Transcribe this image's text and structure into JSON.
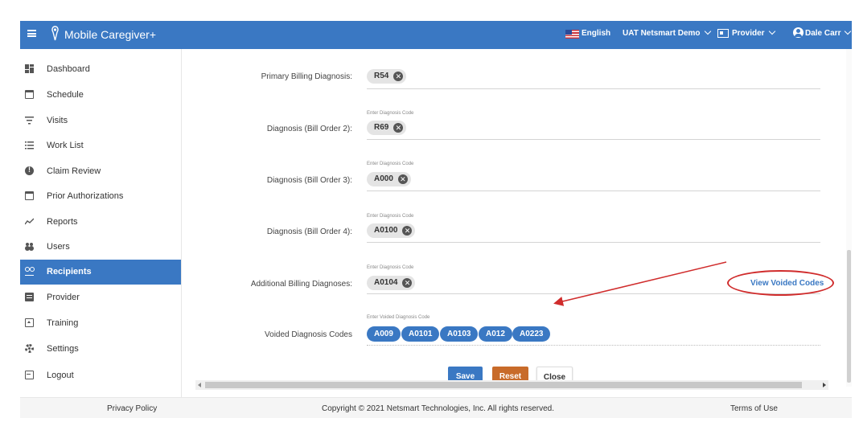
{
  "header": {
    "app_name": "Mobile Caregiver+",
    "language": "English",
    "environment": "UAT Netsmart Demo",
    "role": "Provider",
    "user": "Dale Carr"
  },
  "sidebar": {
    "items": [
      {
        "label": "Dashboard",
        "icon": "dashboard-icon"
      },
      {
        "label": "Schedule",
        "icon": "calendar-icon"
      },
      {
        "label": "Visits",
        "icon": "filter-icon"
      },
      {
        "label": "Work List",
        "icon": "list-icon"
      },
      {
        "label": "Claim Review",
        "icon": "alert-icon"
      },
      {
        "label": "Prior Authorizations",
        "icon": "calendar-icon"
      },
      {
        "label": "Reports",
        "icon": "chart-line-icon"
      },
      {
        "label": "Users",
        "icon": "users-icon"
      },
      {
        "label": "Recipients",
        "icon": "recipients-icon",
        "active": true
      },
      {
        "label": "Provider",
        "icon": "provider-icon"
      },
      {
        "label": "Training",
        "icon": "training-icon"
      },
      {
        "label": "Settings",
        "icon": "gear-icon"
      },
      {
        "label": "Logout",
        "icon": "logout-icon"
      }
    ]
  },
  "form": {
    "primary": {
      "label": "Primary Billing Diagnosis:",
      "code": "R54"
    },
    "bill2": {
      "label": "Diagnosis (Bill Order 2):",
      "hint": "Enter Diagnosis Code",
      "code": "R69"
    },
    "bill3": {
      "label": "Diagnosis (Bill Order 3):",
      "hint": "Enter Diagnosis Code",
      "code": "A000"
    },
    "bill4": {
      "label": "Diagnosis (Bill Order 4):",
      "hint": "Enter Diagnosis Code",
      "code": "A0100"
    },
    "additional": {
      "label": "Additional Billing Diagnoses:",
      "hint": "Enter Diagnosis Code",
      "code": "A0104",
      "link": "View Voided Codes"
    },
    "voided": {
      "label": "Voided Diagnosis Codes",
      "hint": "Enter Voided Diagnosis Code",
      "codes": [
        "A009",
        "A0101",
        "A0103",
        "A012",
        "A0223"
      ]
    }
  },
  "actions": {
    "save": "Save",
    "reset": "Reset",
    "close": "Close"
  },
  "footer": {
    "privacy": "Privacy Policy",
    "copyright": "Copyright © 2021 Netsmart Technologies, Inc. All rights reserved.",
    "terms": "Terms of Use"
  },
  "colors": {
    "brand": "#3a78c3",
    "reset": "#c86b2a",
    "annotation": "#d02c2c"
  }
}
